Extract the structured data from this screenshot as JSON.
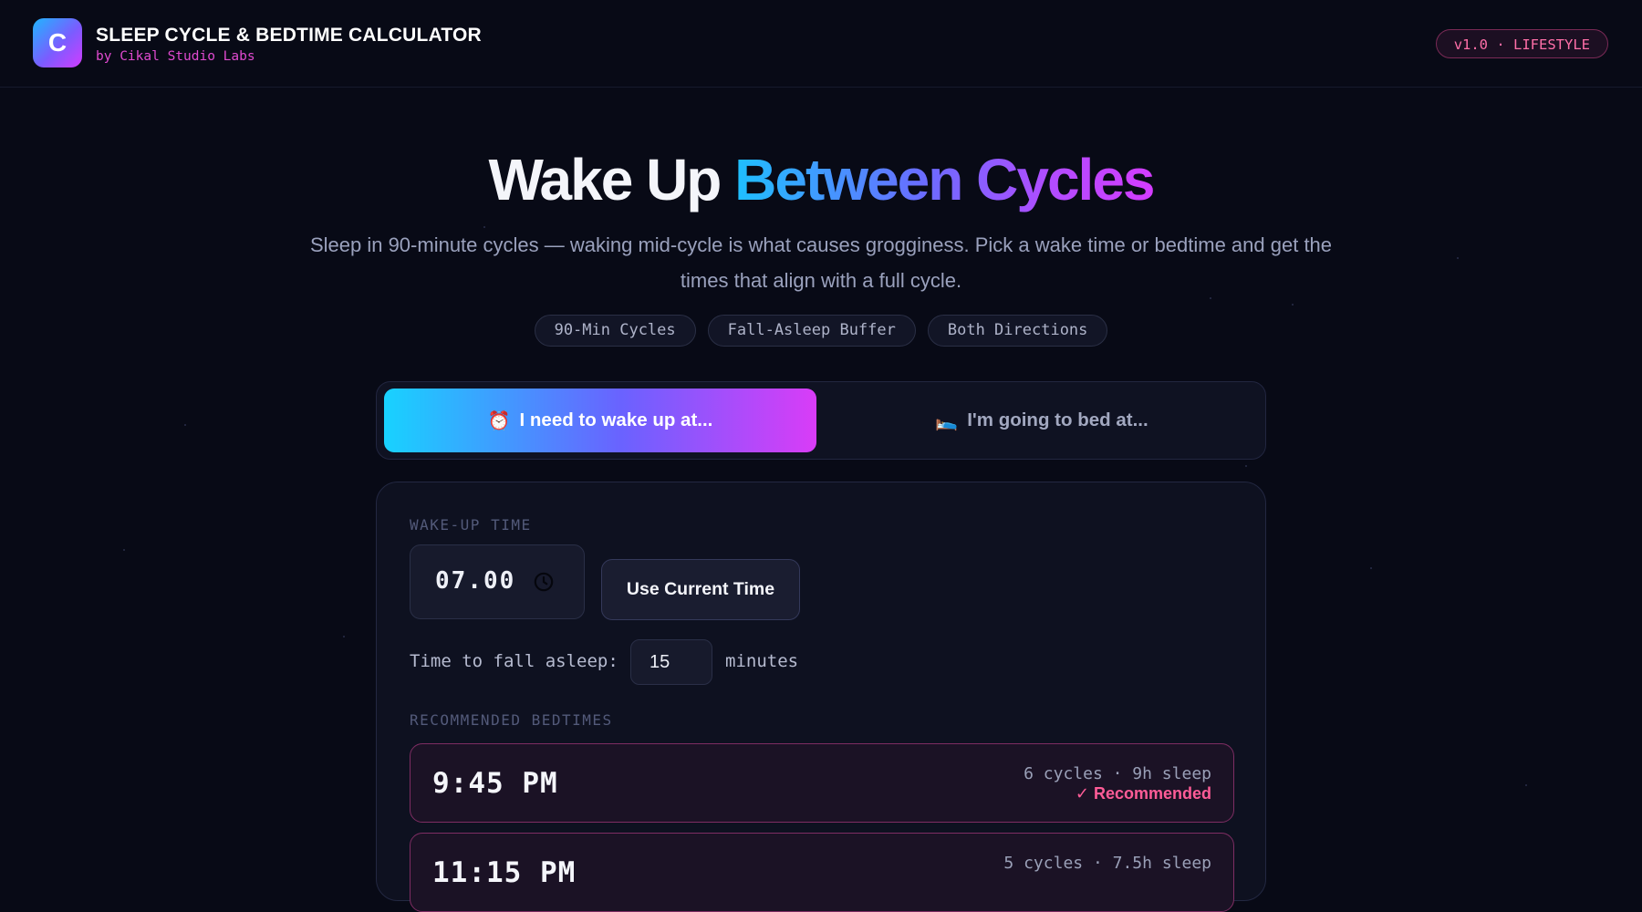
{
  "header": {
    "logo_letter": "C",
    "title": "SLEEP CYCLE & BEDTIME CALCULATOR",
    "subtitle": "by Cikal Studio Labs",
    "version_badge": "v1.0 · LIFESTYLE"
  },
  "hero": {
    "title_plain": "Wake Up ",
    "title_gradient": "Between Cycles",
    "description": "Sleep in 90-minute cycles — waking mid-cycle is what causes grogginess. Pick a wake time or bedtime and get the times that align with a full cycle.",
    "chips": [
      "90-Min Cycles",
      "Fall-Asleep Buffer",
      "Both Directions"
    ]
  },
  "modes": {
    "wake": {
      "emoji": "⏰",
      "label": "I need to wake up at..."
    },
    "bed": {
      "emoji": "🛌",
      "label": "I'm going to bed at..."
    }
  },
  "form": {
    "wake_label": "WAKE-UP TIME",
    "wake_value": "07.00",
    "use_current_label": "Use Current Time",
    "asleep_label": "Time to fall asleep:",
    "asleep_value": "15",
    "minutes_label": "minutes",
    "recommended_label": "RECOMMENDED BEDTIMES"
  },
  "results": [
    {
      "time": "9:45 PM",
      "meta": "6 cycles · 9h sleep",
      "tag": "✓ Recommended"
    },
    {
      "time": "11:15 PM",
      "meta": "5 cycles · 7.5h sleep",
      "tag": ""
    }
  ],
  "colors": {
    "background": "#080a16",
    "accent_pink": "#ff5c97",
    "accent_cyan": "#18d2ff",
    "accent_purple": "#d93cf7"
  }
}
